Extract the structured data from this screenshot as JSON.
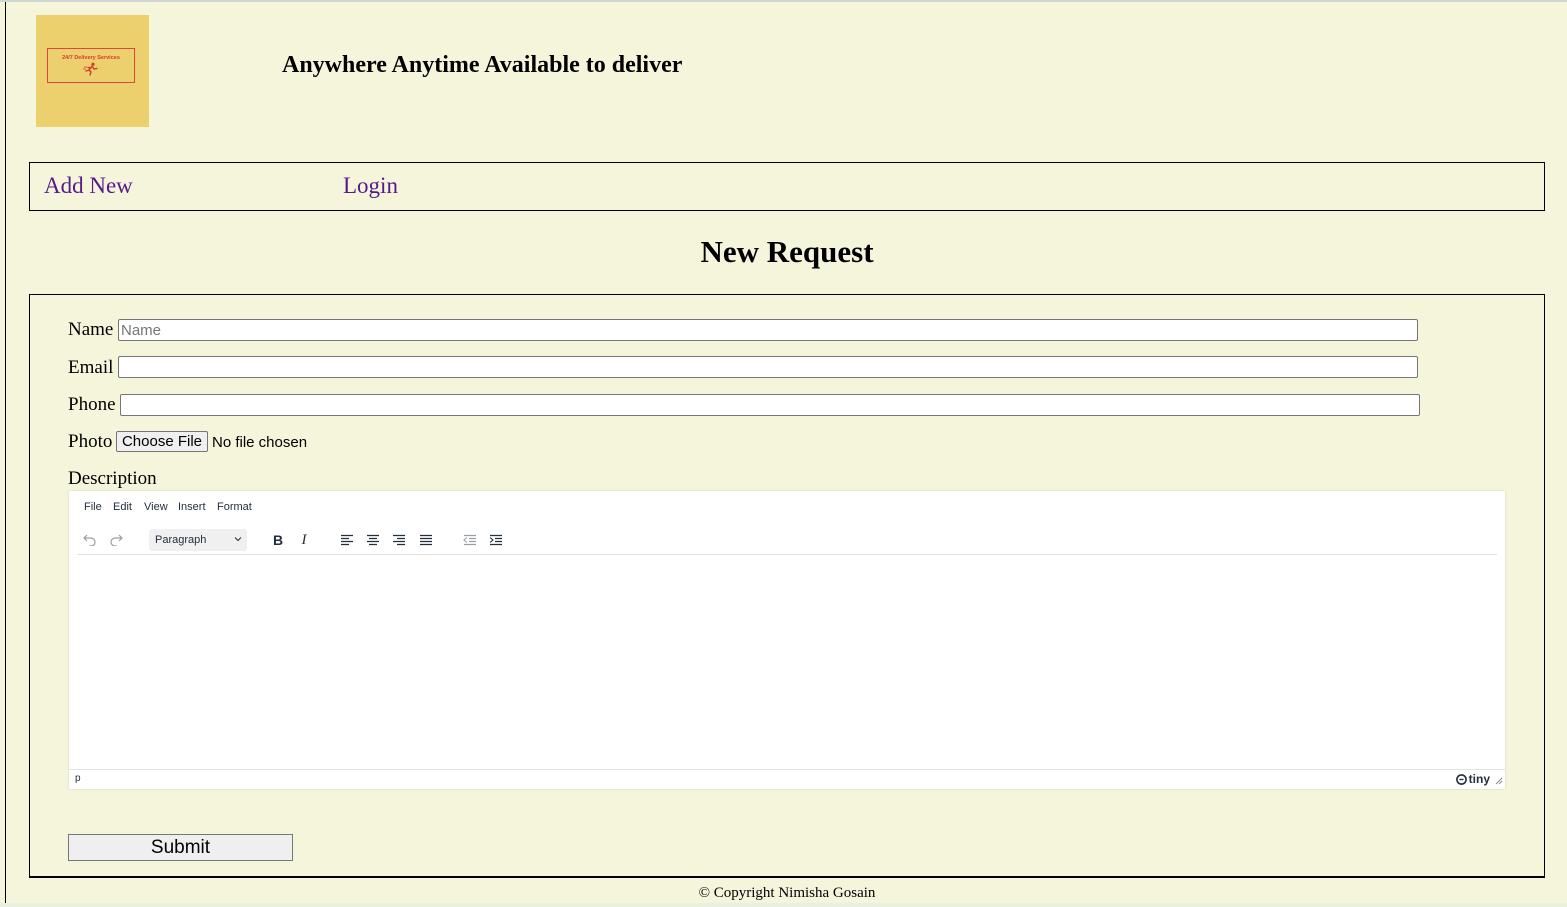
{
  "header": {
    "logo_text": "24/7 Delivery Services",
    "tagline": "Anywhere Anytime Available to deliver"
  },
  "nav": {
    "items": [
      {
        "label": "Add New"
      },
      {
        "label": "Login"
      }
    ]
  },
  "page": {
    "title": "New Request"
  },
  "form": {
    "name_label": "Name",
    "name_placeholder": "Name",
    "name_value": "",
    "email_label": "Email",
    "email_value": "",
    "phone_label": "Phone",
    "phone_value": "",
    "photo_label": "Photo",
    "file_button": "Choose File",
    "file_status": "No file chosen",
    "description_label": "Description",
    "submit_label": "Submit"
  },
  "editor": {
    "menus": [
      "File",
      "Edit",
      "View",
      "Insert",
      "Format"
    ],
    "block_format": "Paragraph",
    "bold_glyph": "B",
    "italic_glyph": "I",
    "status_path": "p",
    "brand": "tiny",
    "icons": [
      "undo-icon",
      "redo-icon",
      "chevron-down-icon",
      "align-left-icon",
      "align-center-icon",
      "align-right-icon",
      "align-justify-icon",
      "outdent-icon",
      "indent-icon",
      "resize-icon"
    ]
  },
  "footer": {
    "copyright": "© Copyright Nimisha Gosain"
  },
  "colors": {
    "page_background": "#f5f5dc",
    "link": "#551a8b",
    "logo_background": "#ecd06d",
    "logo_accent": "#e0463e"
  }
}
